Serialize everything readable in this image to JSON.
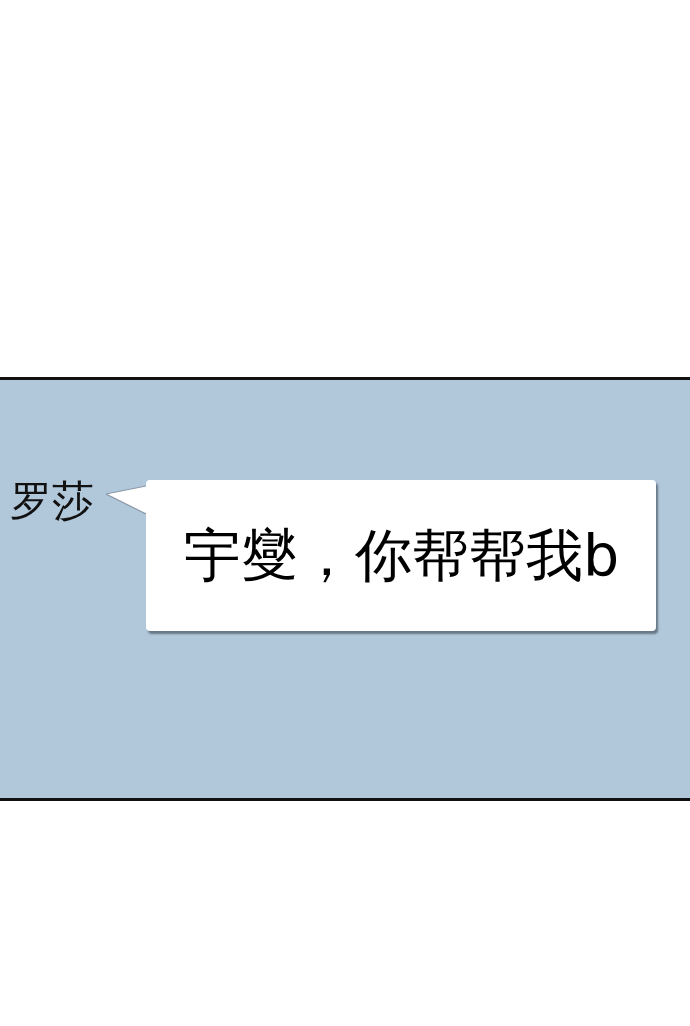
{
  "panel": {
    "speaker": "罗莎",
    "speech_bubble": {
      "text": "宇燮，你帮帮我b"
    }
  }
}
